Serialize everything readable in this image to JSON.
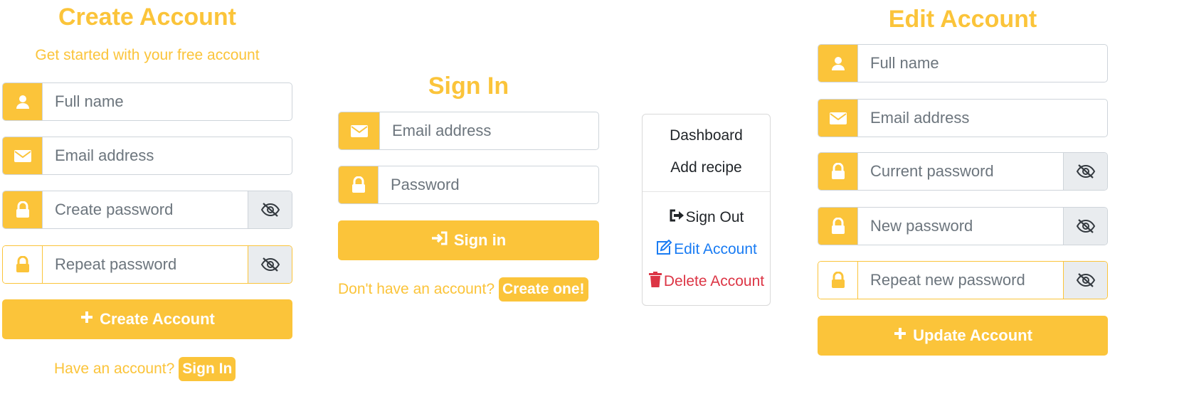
{
  "create_account": {
    "title": "Create Account",
    "subtitle": "Get started with your free account",
    "full_name_placeholder": "Full name",
    "email_placeholder": "Email address",
    "create_password_placeholder": "Create password",
    "repeat_password_placeholder": "Repeat password",
    "submit_label": "Create Account",
    "footer_text": "Have an account?",
    "footer_link": "Sign In"
  },
  "sign_in": {
    "title": "Sign In",
    "email_placeholder": "Email address",
    "password_placeholder": "Password",
    "submit_label": "Sign in",
    "footer_text": "Don't have an account?",
    "footer_link": "Create one!"
  },
  "account_menu": {
    "items": [
      "Dashboard",
      "Add recipe"
    ],
    "sign_out": "Sign Out",
    "edit_account": "Edit Account",
    "delete_account": "Delete Account"
  },
  "edit_account": {
    "title": "Edit Account",
    "full_name_placeholder": "Full name",
    "email_placeholder": "Email address",
    "current_password_placeholder": "Current password",
    "new_password_placeholder": "New password",
    "repeat_new_password_placeholder": "Repeat new password",
    "submit_label": "Update Account"
  },
  "colors": {
    "accent": "#fbc43a",
    "addon_gray": "#e9ecef",
    "link_blue": "#1a7cf3",
    "danger_red": "#dc3545"
  },
  "icons": [
    "user-icon",
    "envelope-icon",
    "lock-icon",
    "eye-slash-icon",
    "plus-icon",
    "sign-in-icon",
    "sign-out-icon",
    "edit-icon",
    "trash-icon"
  ]
}
